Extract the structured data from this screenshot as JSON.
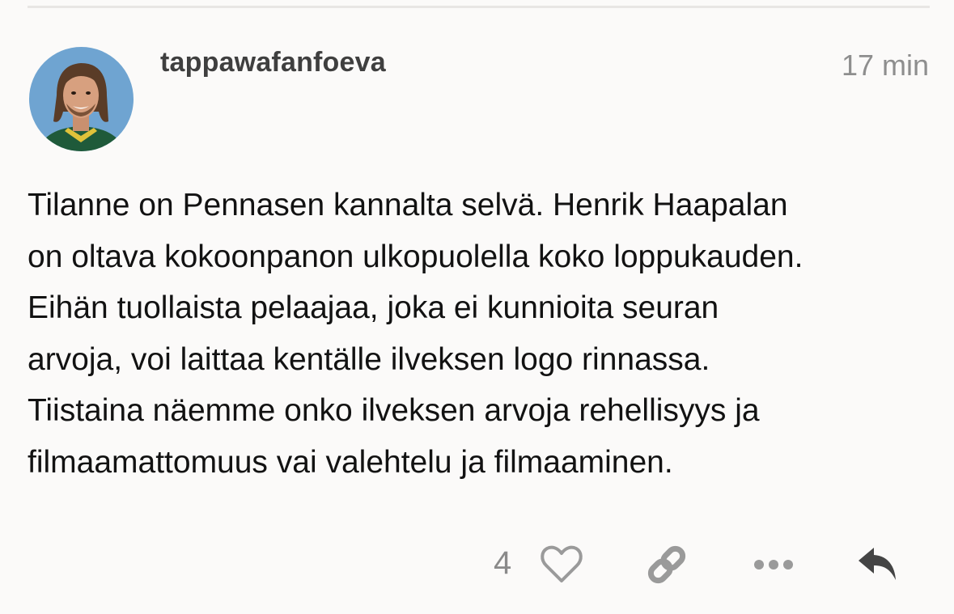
{
  "post": {
    "username": "tappawafanfoeva",
    "timestamp": "17 min",
    "body": "Tilanne on Pennasen kannalta selvä. Henrik Haapalan\non oltava kokoonpanon ulkopuolella koko loppukauden.\nEihän tuollaista pelaajaa, joka ei kunnioita seuran\narvoja, voi laittaa kentälle ilveksen logo rinnassa.\nTiistaina näemme onko ilveksen arvoja rehellisyys ja\nfilmaamattomuus vai valehtelu ja filmaaminen."
  },
  "actions": {
    "like_count": "4",
    "icons": [
      "heart-icon",
      "link-icon",
      "more-icon",
      "reply-icon"
    ]
  },
  "colors": {
    "background": "#fbfaf9",
    "icon_gray": "#9a9a9a",
    "reply_dark": "#444444",
    "username": "#3f3f3f",
    "timestamp": "#8e8e8e"
  }
}
